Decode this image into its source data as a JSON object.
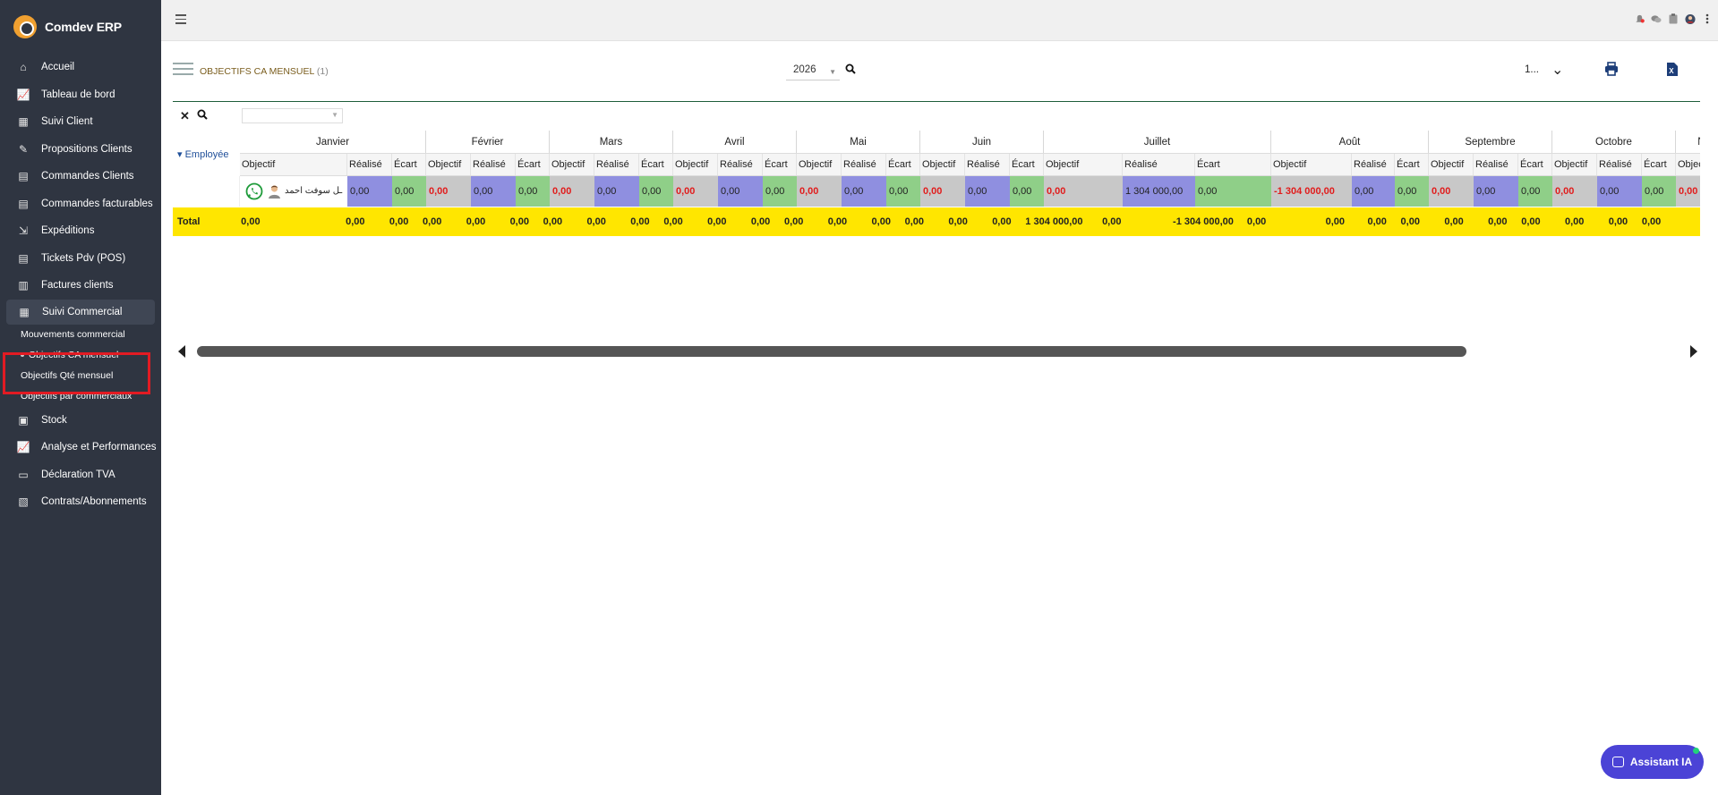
{
  "app": {
    "title": "Comdev ERP"
  },
  "sidebar": {
    "items": [
      {
        "label": "Accueil",
        "icon": "home-icon"
      },
      {
        "label": "Tableau de bord",
        "icon": "chart-line-icon"
      },
      {
        "label": "Suivi Client",
        "icon": "building-icon"
      },
      {
        "label": "Propositions Clients",
        "icon": "file-signature-icon"
      },
      {
        "label": "Commandes Clients",
        "icon": "file-icon"
      },
      {
        "label": "Commandes facturables",
        "icon": "file-icon"
      },
      {
        "label": "Expéditions",
        "icon": "dolly-icon"
      },
      {
        "label": "Tickets Pdv (POS)",
        "icon": "file-icon"
      },
      {
        "label": "Factures clients",
        "icon": "file-invoice-icon"
      },
      {
        "label": "Suivi Commercial",
        "icon": "building-icon"
      }
    ],
    "sub_items": [
      {
        "label": "Mouvements commercial"
      },
      {
        "label": "Objectifs CA mensuel"
      },
      {
        "label": "Objectifs Qté mensuel"
      },
      {
        "label": "Objectifs par commerciaux"
      }
    ],
    "items_after": [
      {
        "label": "Stock",
        "icon": "box-icon"
      },
      {
        "label": "Analyse et Performances",
        "icon": "chart-line-icon"
      },
      {
        "label": "Déclaration TVA",
        "icon": "money-check-icon"
      },
      {
        "label": "Contrats/Abonnements",
        "icon": "briefcase-icon"
      }
    ]
  },
  "page": {
    "title": "OBJECTIFS CA MENSUEL",
    "count": "(1)",
    "year": "2026",
    "page_size": "1..."
  },
  "grid": {
    "group_header": "Employée",
    "months": [
      "Janvier",
      "Février",
      "Mars",
      "Avril",
      "Mai",
      "Juin",
      "Juillet",
      "Août",
      "Septembre",
      "Octobre",
      "Nov"
    ],
    "sub_headers": [
      "Objectif",
      "Réalisé",
      "Écart"
    ],
    "employee_name": "ـل سوفت احمد",
    "row_values": [
      [
        "0,00",
        "0,00",
        "0,00"
      ],
      [
        "0,00",
        "0,00",
        "0,00"
      ],
      [
        "0,00",
        "0,00",
        "0,00"
      ],
      [
        "0,00",
        "0,00",
        "0,00"
      ],
      [
        "0,00",
        "0,00",
        "0,00"
      ],
      [
        "0,00",
        "0,00",
        "0,00"
      ],
      [
        "0,00",
        "1 304 000,00",
        "0,00"
      ],
      [
        "-1 304 000,00",
        "0,00",
        "0,00"
      ],
      [
        "0,00",
        "0,00",
        "0,00"
      ],
      [
        "0,00",
        "0,00",
        "0,00"
      ],
      [
        "0,00",
        ""
      ]
    ],
    "total_label": "Total",
    "total_values": [
      [
        "0,00",
        "0,00",
        "0,00"
      ],
      [
        "0,00",
        "0,00",
        "0,00"
      ],
      [
        "0,00",
        "0,00",
        "0,00"
      ],
      [
        "0,00",
        "0,00",
        "0,00"
      ],
      [
        "0,00",
        "0,00",
        "0,00"
      ],
      [
        "0,00",
        "0,00",
        "0,00"
      ],
      [
        "1 304 000,00",
        "0,00",
        "-1 304 000,00"
      ],
      [
        "0,00",
        "0,00",
        "0,00"
      ],
      [
        "0,00",
        "0,00",
        "0,00"
      ],
      [
        "0,00",
        "0,00",
        "0,00"
      ],
      [
        "0,00",
        ""
      ]
    ]
  },
  "assistant": {
    "label": "Assistant IA"
  },
  "colors": {
    "sidebar_bg": "#2f3541",
    "objectif_cell": "#c8c8c8",
    "realise_cell": "#8f8fe0",
    "ecart_cell": "#8fcf88",
    "negative_text": "#e11c1c",
    "total_row": "#ffe600",
    "highlight": "#e21b23",
    "assistant_bg": "#4b43d6"
  }
}
